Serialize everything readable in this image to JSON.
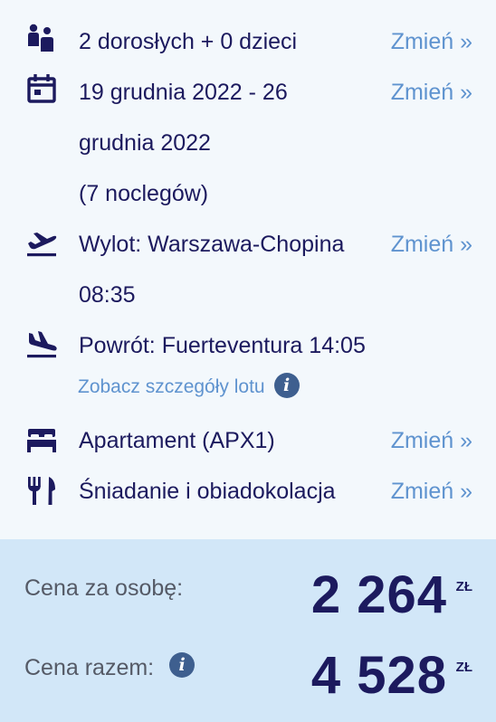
{
  "change_label": "Zmień »",
  "travelers": {
    "icon": "family-icon",
    "text": "2 dorosłych + 0 dzieci"
  },
  "dates": {
    "icon": "calendar-icon",
    "line1": "19 grudnia 2022 - 26",
    "line2": "grudnia 2022",
    "line3": "(7 noclegów)"
  },
  "departure": {
    "icon": "plane-takeoff-icon",
    "line1": "Wylot: Warszawa-Chopina",
    "line2": "08:35"
  },
  "return_flight": {
    "icon": "plane-landing-icon",
    "text": "Powrót: Fuerteventura 14:05",
    "details_link": "Zobacz szczegóły lotu"
  },
  "room": {
    "icon": "bed-icon",
    "text": "Apartament (APX1)"
  },
  "board": {
    "icon": "fork-knife-icon",
    "text": "Śniadanie i obiadokolacja"
  },
  "info_icon_glyph": "i",
  "price": {
    "per_person_label": "Cena za osobę:",
    "per_person_value": "2 264",
    "total_label": "Cena razem:",
    "total_value": "4 528",
    "currency": "ZŁ"
  },
  "colors": {
    "text_primary": "#1c1a5e",
    "link": "#5f93cf",
    "background": "#f3f8fc",
    "price_background": "#d2e7f8",
    "info_badge": "#3e5f8f"
  }
}
